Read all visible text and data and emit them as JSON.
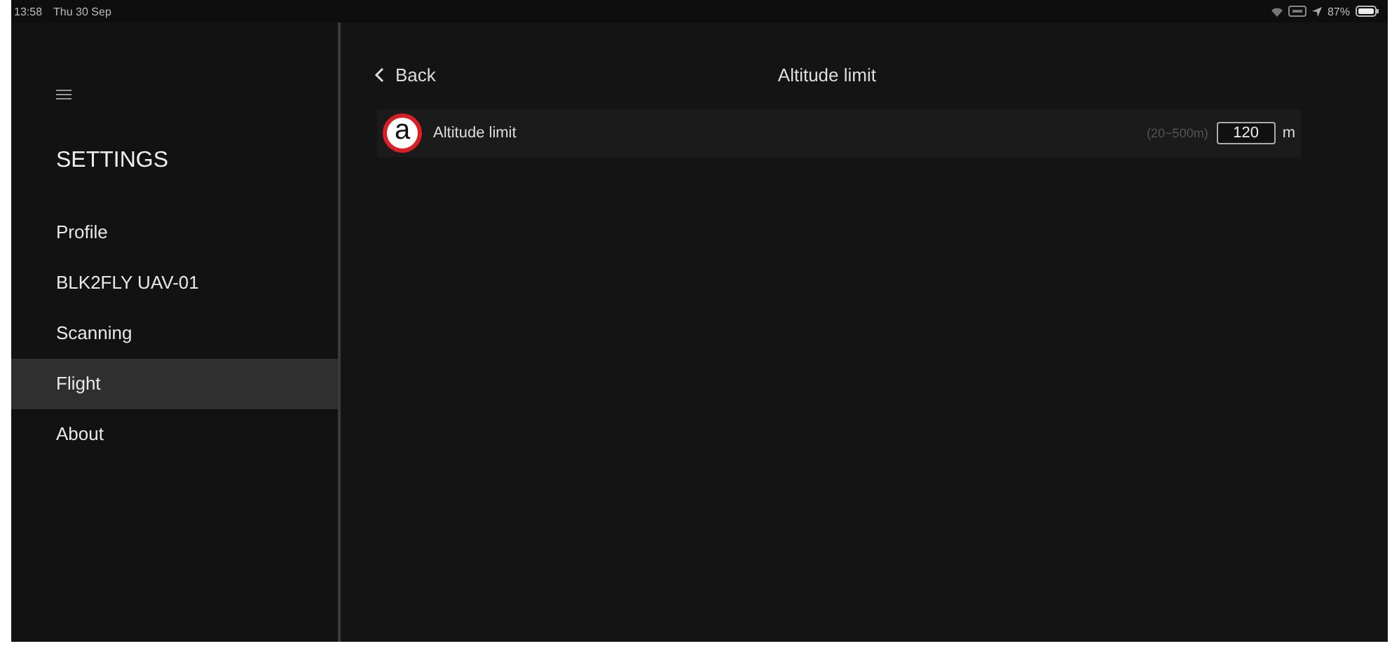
{
  "status_bar": {
    "time": "13:58",
    "date": "Thu 30 Sep",
    "battery_percent": "87%"
  },
  "sidebar": {
    "title": "SETTINGS",
    "items": [
      {
        "label": "Profile",
        "selected": false
      },
      {
        "label": "BLK2FLY UAV-01",
        "selected": false
      },
      {
        "label": "Scanning",
        "selected": false
      },
      {
        "label": "Flight",
        "selected": true
      },
      {
        "label": "About",
        "selected": false
      }
    ]
  },
  "header": {
    "back": "Back",
    "title": "Altitude limit"
  },
  "settings": [
    {
      "callout": "a",
      "label": "Altitude limit",
      "range": "(20~500m)",
      "value": "120",
      "unit": "m"
    }
  ]
}
